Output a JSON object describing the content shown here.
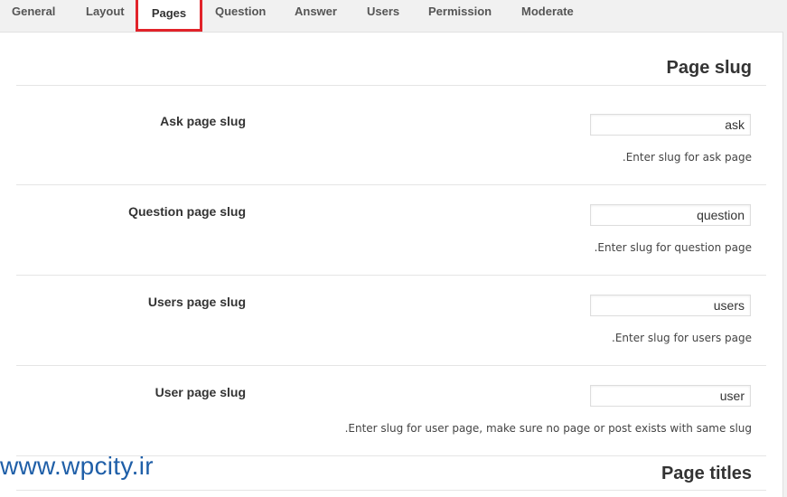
{
  "tabs": [
    {
      "label": "General"
    },
    {
      "label": "Layout"
    },
    {
      "label": "Pages",
      "active": true
    },
    {
      "label": "Question"
    },
    {
      "label": "Answer"
    },
    {
      "label": "Users"
    },
    {
      "label": "Permission"
    },
    {
      "label": "Moderate"
    }
  ],
  "page_slug": {
    "title": "Page slug",
    "fields": [
      {
        "label": "Ask page slug",
        "value": "ask",
        "description": "Enter slug for ask page."
      },
      {
        "label": "Question page slug",
        "value": "question",
        "description": "Enter slug for question page."
      },
      {
        "label": "Users page slug",
        "value": "users",
        "description": "Enter slug for users page."
      },
      {
        "label": "User page slug",
        "value": "user",
        "description": "Enter slug for user page, make sure no page or post exists with same slug."
      }
    ]
  },
  "page_titles": {
    "title": "Page titles"
  },
  "watermark": "www.wpcity.ir",
  "colors": {
    "active_tab_border": "#e1232a",
    "watermark": "#1f5fa8"
  }
}
